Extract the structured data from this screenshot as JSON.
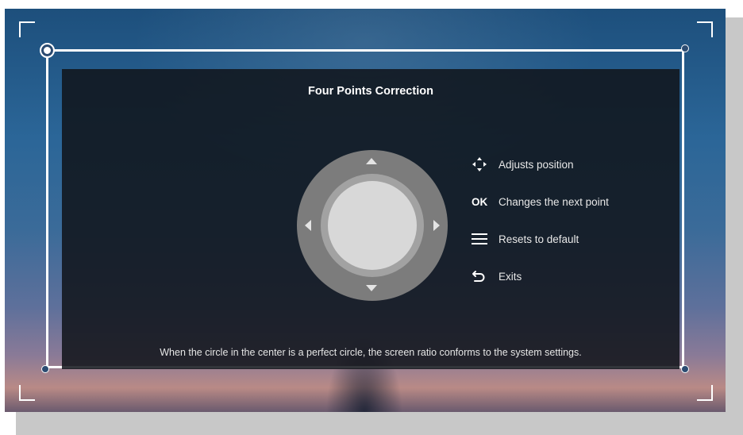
{
  "panel": {
    "title": "Four Points Correction",
    "hint": "When the circle in the center is a perfect circle, the screen ratio conforms to the system settings."
  },
  "legend": [
    {
      "icon": "arrows-move-icon",
      "label": "Adjusts position"
    },
    {
      "icon": "ok-key-icon",
      "label": "Changes the next point",
      "key_text": "OK"
    },
    {
      "icon": "menu-icon",
      "label": "Resets to default"
    },
    {
      "icon": "back-icon",
      "label": "Exits"
    }
  ],
  "colors": {
    "frame": "#ffffff",
    "panel": "#10141a",
    "dpad_outer": "#7c7c7c",
    "dpad_inner": "#a2a2a2",
    "dpad_center": "#d8d8d8"
  }
}
